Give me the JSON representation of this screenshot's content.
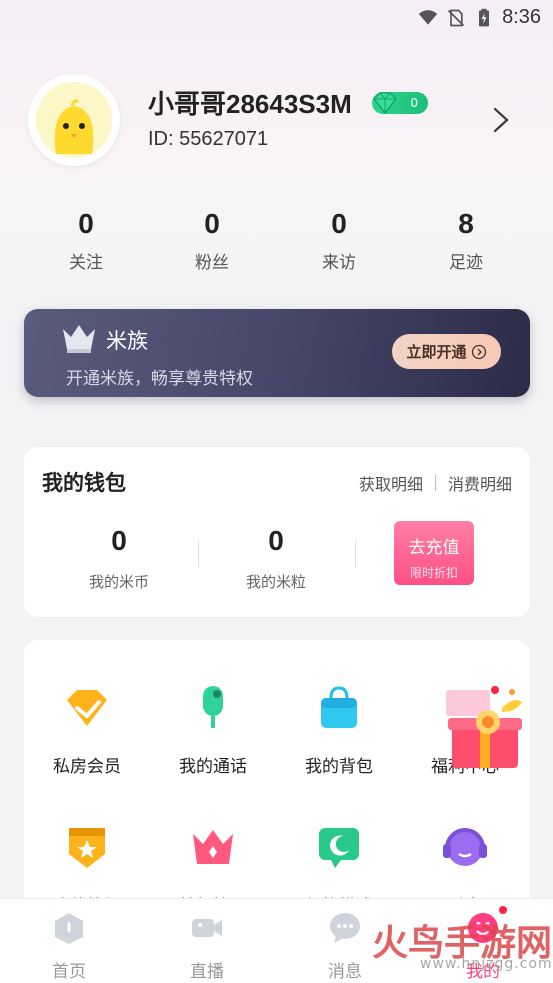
{
  "status_bar": {
    "time": "8:36",
    "icons": [
      "wifi-icon",
      "no-sim-icon",
      "battery-charging-icon"
    ]
  },
  "profile": {
    "username": "小哥哥28643S3M",
    "level": "0",
    "user_id": "ID: 55627071",
    "avatar_icon": "chick-avatar-icon"
  },
  "stats": [
    {
      "value": "0",
      "label": "关注"
    },
    {
      "value": "0",
      "label": "粉丝"
    },
    {
      "value": "0",
      "label": "来访"
    },
    {
      "value": "8",
      "label": "足迹"
    }
  ],
  "vip": {
    "title": "米族",
    "description": "开通米族，畅享尊贵特权",
    "button_label": "立即开通"
  },
  "wallet": {
    "title": "我的钱包",
    "link_income": "获取明细",
    "link_expense": "消费明细",
    "coins_value": "0",
    "coins_label": "我的米币",
    "grains_value": "0",
    "grains_label": "我的米粒",
    "recharge_label": "去充值",
    "recharge_sub": "限时折扣"
  },
  "grid_items": [
    {
      "label": "私房会员",
      "icon": "diamond-icon"
    },
    {
      "label": "我的通话",
      "icon": "microphone-icon"
    },
    {
      "label": "我的背包",
      "icon": "bag-icon"
    },
    {
      "label": "福利中心",
      "icon": "gift-box-icon"
    },
    {
      "label": "我的等级",
      "icon": "level-badge-icon"
    },
    {
      "label": "特权管理",
      "icon": "crown-icon"
    },
    {
      "label": "勿扰模式",
      "icon": "moon-icon"
    },
    {
      "label": "联系客服",
      "icon": "headset-icon"
    }
  ],
  "bottom_nav": [
    {
      "label": "首页",
      "icon": "home-icon",
      "active": false
    },
    {
      "label": "直播",
      "icon": "video-camera-icon",
      "active": false
    },
    {
      "label": "消息",
      "icon": "chat-icon",
      "active": false
    },
    {
      "label": "我的",
      "icon": "profile-icon",
      "active": true
    }
  ],
  "watermark": {
    "text": "火鸟手游网",
    "url": "www.hnjzgg.com"
  },
  "colors": {
    "accent": "#ff3f82",
    "vip_card": "#46476a",
    "level_badge": "#2ed58d"
  }
}
